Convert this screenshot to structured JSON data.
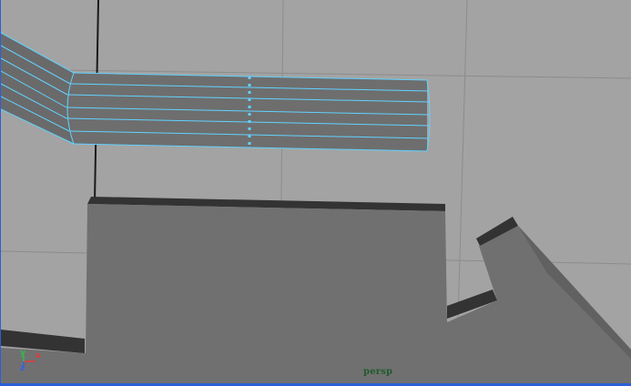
{
  "viewport": {
    "camera_label": "persp",
    "colors": {
      "background": "#a3a3a3",
      "grid": "#8c8c8c",
      "grid_axis": "#1a1a1a",
      "mesh_face": "#6e6e6e",
      "mesh_dark": "#3a3a3a",
      "selection_wire": "#62d2ff",
      "camera_label": "#1f5a2c",
      "border": "#2b5fd9"
    }
  },
  "axis_gizmo": {
    "x_label": "x",
    "y_label": "y",
    "z_label": "z",
    "x_color": "#e23b3b",
    "y_color": "#2fc04b",
    "z_color": "#3b5fe2"
  }
}
